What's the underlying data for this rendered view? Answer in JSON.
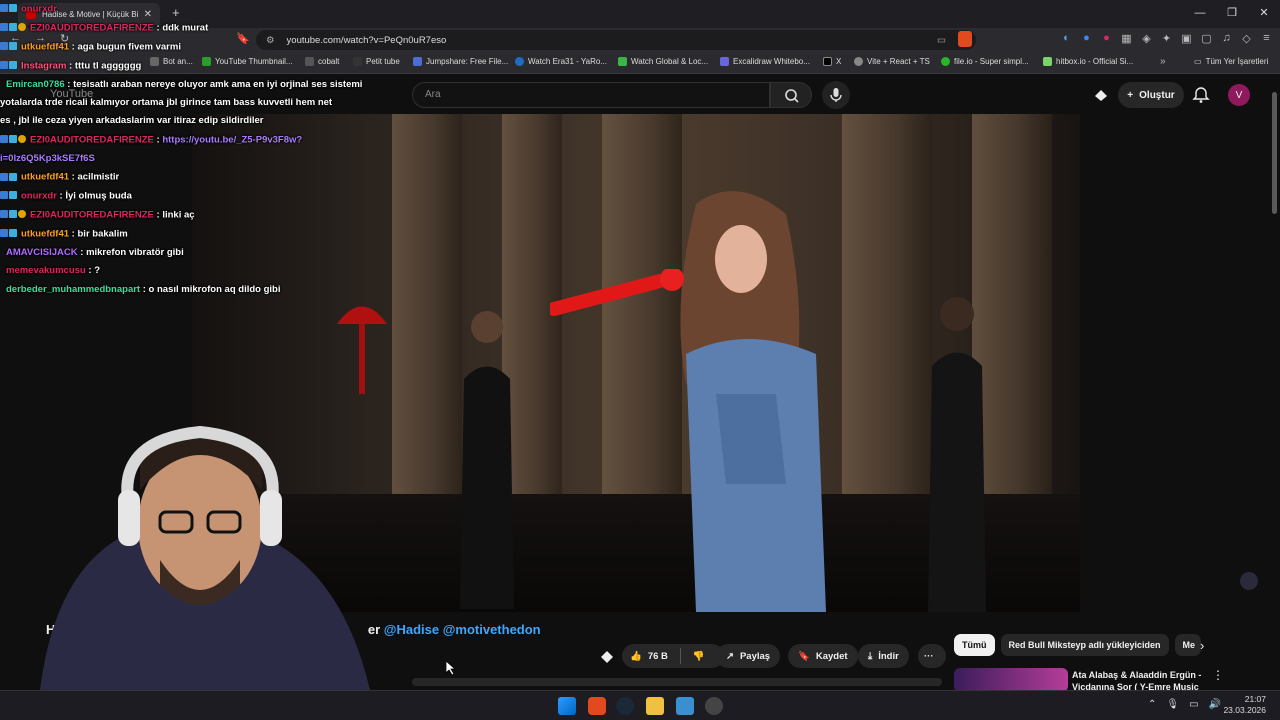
{
  "browser": {
    "tab_title": "Hadise & Motive | Küçük Bir",
    "url": "youtube.com/watch?v=PeQn0uR7eso",
    "bookmarks": [
      "Instagram",
      "Bot an...",
      "YouTube Thumbnail...",
      "cobalt",
      "Petit tube",
      "Jumpshare: Free File...",
      "Watch Era31 - YaRo...",
      "Watch Global & Loc...",
      "Excalidraw Whitebo...",
      "X",
      "Vite + React + TS",
      "file.io - Super simpl...",
      "hitbox.io - Official Si..."
    ],
    "all_bookmarks": "Tüm Yer İşaretleri"
  },
  "youtube": {
    "logo": "YouTube",
    "search_placeholder": "Ara",
    "create_label": "Oluştur",
    "avatar_letter": "V"
  },
  "chat": [
    {
      "user": "onurxdr",
      "color": "#e0245e",
      "msg": "ddk murat",
      "badges": 2
    },
    {
      "user": "EZI0AUDITOREDAFIRENZE",
      "color": "#e0245e",
      "msg": "ddk murat",
      "badges": 3
    },
    {
      "user": "utkuefdf41",
      "color": "#ff9f1c",
      "msg": "aga bugun fivem varmi",
      "badges": 2
    },
    {
      "user": "Instagram",
      "color": "#ff4f7a",
      "msg": "tttu tl agggggg",
      "badges": 2
    },
    {
      "user": "Emircan0786",
      "color": "#35e0a0",
      "msg": "tesisatlı araban nereye oluyor amk ama en iyi orjinal ses sistemi",
      "badges": 0
    },
    {
      "user": "",
      "color": "#fff",
      "msg": "yotalarda trde ricali kalmıyor ortama jbl girince tam bass kuvvetli hem net",
      "badges": 0
    },
    {
      "user": "",
      "color": "#fff",
      "msg": "es , jbl ile ceza yiyen arkadaslarim var itiraz edip sildirdiler",
      "badges": 0
    },
    {
      "user": "EZI0AUDITOREDAFIRENZE",
      "color": "#e0245e",
      "msg": "https://youtu.be/_Z5-P9v3F8w?",
      "badges": 3,
      "link": true
    },
    {
      "user": "",
      "color": "#fff",
      "msg": "i=0lz6Q5Kp3kSE7f6S",
      "badges": 0,
      "link": true
    },
    {
      "user": "utkuefdf41",
      "color": "#ff9f1c",
      "msg": "acilmistir",
      "badges": 2
    },
    {
      "user": "onurxdr",
      "color": "#e0245e",
      "msg": "İyi olmuş buda",
      "badges": 2
    },
    {
      "user": "EZI0AUDITOREDAFIRENZE",
      "color": "#e0245e",
      "msg": "linki aç",
      "badges": 3
    },
    {
      "user": "utkuefdf41",
      "color": "#ff9f1c",
      "msg": "bir bakalim",
      "badges": 2
    },
    {
      "user": "AMAVCISIJACK",
      "color": "#b06cff",
      "msg": "mikrefon vibratör gibi",
      "badges": 0
    },
    {
      "user": "memevakumcusu",
      "color": "#e0245e",
      "msg": "?",
      "badges": 0
    },
    {
      "user": "derbeder_muhammedbnapart",
      "color": "#35e0a0",
      "msg": "o nasıl mikrofon aq dildo gibi",
      "badges": 0
    }
  ],
  "video": {
    "title_prefix": "Ha",
    "title_suffix": "er",
    "mentions": "@Hadise @motivethedon",
    "likes": "76 B",
    "share": "Paylaş",
    "save": "Kaydet",
    "download": "İndir",
    "more": "···"
  },
  "chips": [
    "Tümü",
    "Red Bull Miksteyp adlı yükleyiciden",
    "Me"
  ],
  "recommendation": {
    "title": "Ata Alabaş & Alaaddin Ergün - Vicdanına Sor ( Y-Emre Music",
    "more": "⋮"
  },
  "taskbar": {
    "time": "21:07",
    "date": "23.03.2026"
  }
}
